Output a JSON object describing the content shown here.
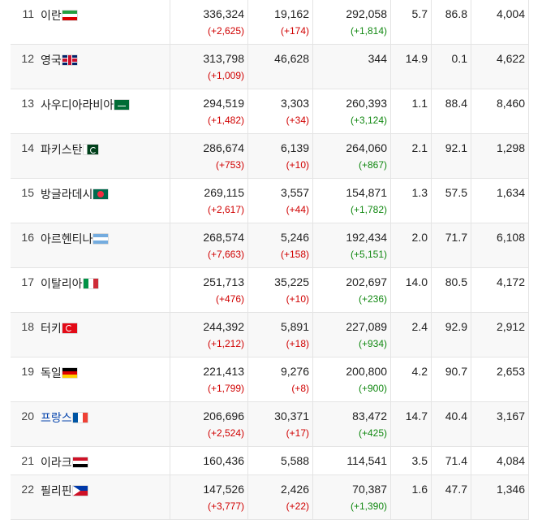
{
  "rows": [
    {
      "rank": "11",
      "name": "이란",
      "flag": "ir",
      "flag_icon": "iran-flag-icon",
      "cases": "336,324",
      "cases_delta": "(+2,625)",
      "deaths": "19,162",
      "deaths_delta": "(+174)",
      "recovered": "292,058",
      "recovered_delta": "(+1,814)",
      "p1": "5.7",
      "p2": "86.8",
      "last": "4,004"
    },
    {
      "rank": "12",
      "name": "영국",
      "flag": "uk",
      "flag_icon": "uk-flag-icon",
      "cases": "313,798",
      "cases_delta": "(+1,009)",
      "deaths": "46,628",
      "deaths_delta": "",
      "recovered": "344",
      "recovered_delta": "",
      "p1": "14.9",
      "p2": "0.1",
      "last": "4,622"
    },
    {
      "rank": "13",
      "name": "사우디아라비아",
      "flag": "sa",
      "flag_icon": "saudi-arabia-flag-icon",
      "cases": "294,519",
      "cases_delta": "(+1,482)",
      "deaths": "3,303",
      "deaths_delta": "(+34)",
      "recovered": "260,393",
      "recovered_delta": "(+3,124)",
      "p1": "1.1",
      "p2": "88.4",
      "last": "8,460"
    },
    {
      "rank": "14",
      "name": "파키스탄",
      "flag": "pk",
      "flag_icon": "pakistan-flag-icon",
      "cases": "286,674",
      "cases_delta": "(+753)",
      "deaths": "6,139",
      "deaths_delta": "(+10)",
      "recovered": "264,060",
      "recovered_delta": "(+867)",
      "p1": "2.1",
      "p2": "92.1",
      "last": "1,298"
    },
    {
      "rank": "15",
      "name": "방글라데시",
      "flag": "bd",
      "flag_icon": "bangladesh-flag-icon",
      "cases": "269,115",
      "cases_delta": "(+2,617)",
      "deaths": "3,557",
      "deaths_delta": "(+44)",
      "recovered": "154,871",
      "recovered_delta": "(+1,782)",
      "p1": "1.3",
      "p2": "57.5",
      "last": "1,634"
    },
    {
      "rank": "16",
      "name": "아르헨티나",
      "flag": "ar",
      "flag_icon": "argentina-flag-icon",
      "cases": "268,574",
      "cases_delta": "(+7,663)",
      "deaths": "5,246",
      "deaths_delta": "(+158)",
      "recovered": "192,434",
      "recovered_delta": "(+5,151)",
      "p1": "2.0",
      "p2": "71.7",
      "last": "6,108"
    },
    {
      "rank": "17",
      "name": "이탈리아",
      "flag": "it",
      "flag_icon": "italy-flag-icon",
      "cases": "251,713",
      "cases_delta": "(+476)",
      "deaths": "35,225",
      "deaths_delta": "(+10)",
      "recovered": "202,697",
      "recovered_delta": "(+236)",
      "p1": "14.0",
      "p2": "80.5",
      "last": "4,172"
    },
    {
      "rank": "18",
      "name": "터키",
      "flag": "tr",
      "flag_icon": "turkey-flag-icon",
      "cases": "244,392",
      "cases_delta": "(+1,212)",
      "deaths": "5,891",
      "deaths_delta": "(+18)",
      "recovered": "227,089",
      "recovered_delta": "(+934)",
      "p1": "2.4",
      "p2": "92.9",
      "last": "2,912"
    },
    {
      "rank": "19",
      "name": "독일",
      "flag": "de",
      "flag_icon": "germany-flag-icon",
      "cases": "221,413",
      "cases_delta": "(+1,799)",
      "deaths": "9,276",
      "deaths_delta": "(+8)",
      "recovered": "200,800",
      "recovered_delta": "(+900)",
      "p1": "4.2",
      "p2": "90.7",
      "last": "2,653"
    },
    {
      "rank": "20",
      "name": "프랑스",
      "flag": "fr",
      "flag_icon": "france-flag-icon",
      "link": true,
      "cases": "206,696",
      "cases_delta": "(+2,524)",
      "deaths": "30,371",
      "deaths_delta": "(+17)",
      "recovered": "83,472",
      "recovered_delta": "(+425)",
      "p1": "14.7",
      "p2": "40.4",
      "last": "3,167"
    },
    {
      "rank": "21",
      "name": "이라크",
      "flag": "iq",
      "flag_icon": "iraq-flag-icon",
      "cases": "160,436",
      "cases_delta": "",
      "deaths": "5,588",
      "deaths_delta": "",
      "recovered": "114,541",
      "recovered_delta": "",
      "p1": "3.5",
      "p2": "71.4",
      "last": "4,084"
    },
    {
      "rank": "22",
      "name": "필리핀",
      "flag": "ph",
      "flag_icon": "philippines-flag-icon",
      "cases": "147,526",
      "cases_delta": "(+3,777)",
      "deaths": "2,426",
      "deaths_delta": "(+22)",
      "recovered": "70,387",
      "recovered_delta": "(+1,390)",
      "p1": "1.6",
      "p2": "47.7",
      "last": "1,346"
    }
  ],
  "colors": {
    "increase_red": "#d00000",
    "recovered_green": "#118811",
    "link_blue": "#0645ad"
  }
}
